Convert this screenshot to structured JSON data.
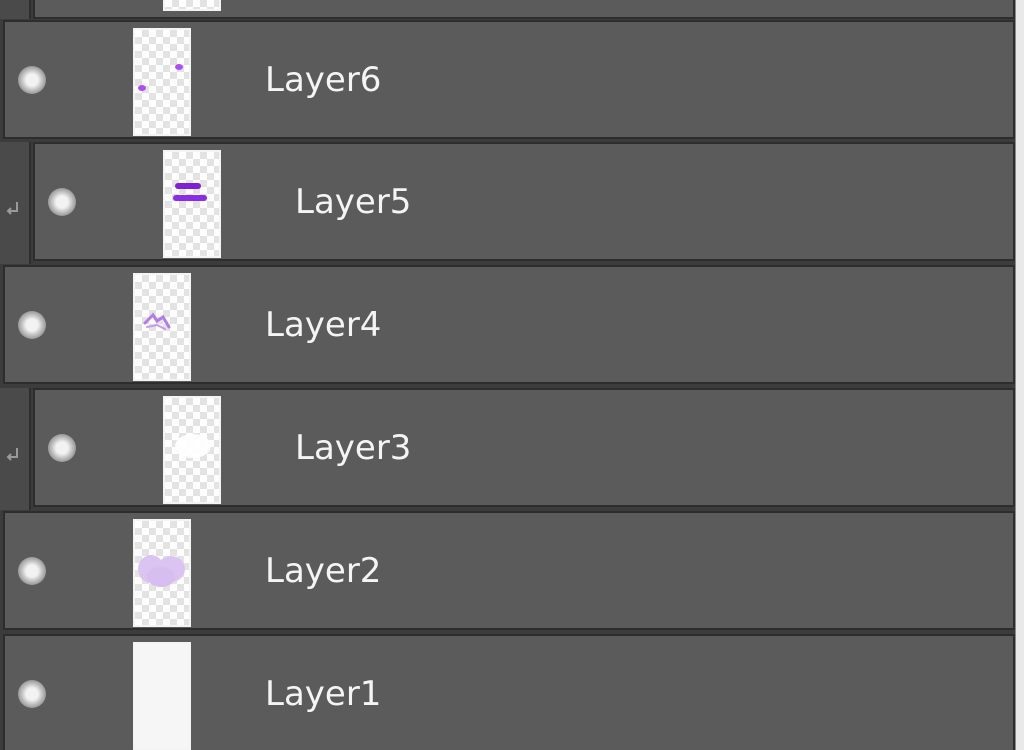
{
  "panel": {
    "layers": [
      {
        "name": "Layer6",
        "clipped": false,
        "visible": true,
        "thumbnail": "small-purple-dots"
      },
      {
        "name": "Layer5",
        "clipped": true,
        "visible": true,
        "thumbnail": "purple-strokes"
      },
      {
        "name": "Layer4",
        "clipped": false,
        "visible": true,
        "thumbnail": "light-purple-scribble"
      },
      {
        "name": "Layer3",
        "clipped": true,
        "visible": true,
        "thumbnail": "white-shape"
      },
      {
        "name": "Layer2",
        "clipped": false,
        "visible": true,
        "thumbnail": "pale-purple-blob"
      },
      {
        "name": "Layer1",
        "clipped": false,
        "visible": true,
        "thumbnail": "white-fill"
      }
    ]
  },
  "colors": {
    "row_bg": "#5b5b5b",
    "row_border": "#2d2d2d",
    "text": "#f4f4f4",
    "accent_purple": "#8a2be2"
  },
  "icons": {
    "visibility": "eye-dot-icon",
    "clipping": "clip-arrow-icon"
  }
}
